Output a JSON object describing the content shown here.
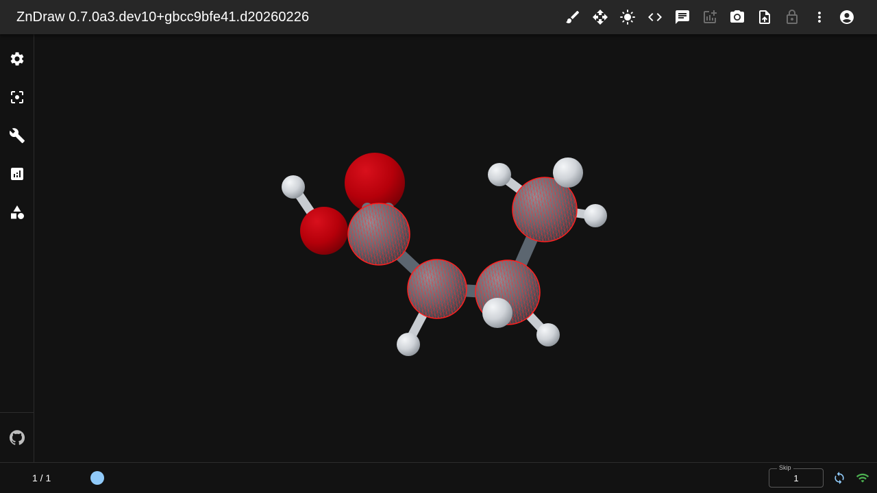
{
  "window": {
    "title": "ZnDraw 0.7.0a3.dev10+gbcc9bfe41.d20260226"
  },
  "toolbar": {
    "items": [
      {
        "icon": "brush-icon",
        "enabled": true
      },
      {
        "icon": "move-icon",
        "enabled": true
      },
      {
        "icon": "brightness-icon",
        "enabled": true
      },
      {
        "icon": "code-icon",
        "enabled": true
      },
      {
        "icon": "chat-icon",
        "enabled": true
      },
      {
        "icon": "add-chart-icon",
        "enabled": false
      },
      {
        "icon": "camera-icon",
        "enabled": true
      },
      {
        "icon": "upload-file-icon",
        "enabled": true
      },
      {
        "icon": "lock-icon",
        "enabled": false
      },
      {
        "icon": "more-vert-icon",
        "enabled": true
      },
      {
        "icon": "account-icon",
        "enabled": true
      }
    ]
  },
  "sidebar": {
    "items": [
      {
        "icon": "gear-icon"
      },
      {
        "icon": "center-focus-icon"
      },
      {
        "icon": "wrench-icon"
      },
      {
        "icon": "analytics-icon"
      },
      {
        "icon": "shapes-icon"
      }
    ],
    "footer_icon": "github-icon"
  },
  "viewer": {
    "molecule": "ball-and-stick",
    "selection_color": "#ff2020",
    "atom_colors": {
      "H": "#d8dbe0",
      "O": "#c0000b",
      "C": "#5a6470"
    }
  },
  "bottombar": {
    "frame_counter": "1 / 1",
    "skip_label": "Skip",
    "skip_value": "1",
    "sync_icon": "sync-icon",
    "connection_icon": "wifi-icon",
    "accent_color": "#90caf9",
    "connected_color": "#4caf50"
  }
}
